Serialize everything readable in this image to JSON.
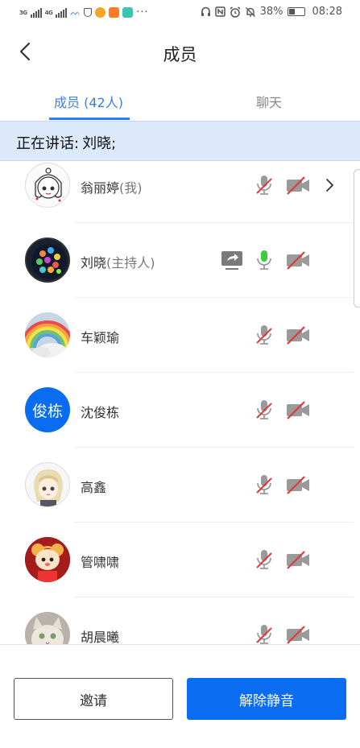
{
  "status_bar": {
    "network1": "3G",
    "network2": "4G",
    "battery": "38%",
    "time": "08:28",
    "icons": [
      "headset-icon",
      "nfc-icon",
      "alarm-icon",
      "mute-icon",
      "battery-icon"
    ]
  },
  "header": {
    "title": "成员",
    "back_icon": "chevron-left-icon"
  },
  "tabs": [
    {
      "label": "成员 (42人)",
      "active": true
    },
    {
      "label": "聊天",
      "active": false
    }
  ],
  "speaking": {
    "label": "正在讲话:",
    "names": "刘晓;"
  },
  "members": [
    {
      "name": "翁丽婷",
      "role": "(我)",
      "avatar": "sketch-girl-avatar",
      "mic": "muted",
      "cam": "off",
      "chevron": true,
      "share": false
    },
    {
      "name": "刘晓",
      "role": "(主持人)",
      "avatar": "colorful-circles-avatar",
      "mic": "active",
      "cam": "off",
      "chevron": false,
      "share": true
    },
    {
      "name": "车颖瑜",
      "role": "",
      "avatar": "rainbow-avatar",
      "mic": "muted",
      "cam": "off",
      "chevron": false,
      "share": false
    },
    {
      "name": "沈俊栋",
      "role": "",
      "avatar_text": "俊栋",
      "avatar": "text-avatar",
      "mic": "muted",
      "cam": "off",
      "chevron": false,
      "share": false
    },
    {
      "name": "高鑫",
      "role": "",
      "avatar": "anime-character-avatar",
      "mic": "muted",
      "cam": "off",
      "chevron": false,
      "share": false
    },
    {
      "name": "管啸啸",
      "role": "",
      "avatar": "cartoon-mouse-avatar",
      "mic": "muted",
      "cam": "off",
      "chevron": false,
      "share": false
    },
    {
      "name": "胡晨曦",
      "role": "",
      "avatar": "cat-avatar",
      "mic": "muted",
      "cam": "off",
      "chevron": false,
      "share": false
    }
  ],
  "buttons": {
    "invite": "邀请",
    "unmute": "解除静音"
  },
  "colors": {
    "accent": "#0a6cf0",
    "mic_active": "#3ec93e",
    "muted_red": "#e0393e",
    "banner": "#dbe9fb"
  }
}
